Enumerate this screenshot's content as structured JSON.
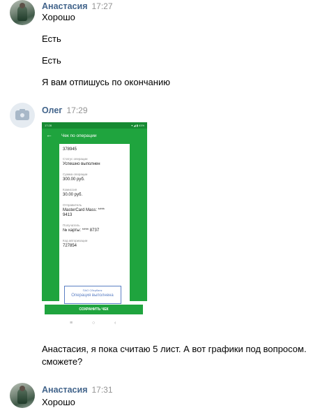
{
  "messages": [
    {
      "author": "Анастасия",
      "time": "17:27",
      "avatar": "user-photo",
      "lines": [
        "Хорошо",
        "Есть",
        "Есть",
        "Я вам отпишусь по окончанию"
      ]
    },
    {
      "author": "Олег",
      "time": "17:29",
      "avatar": "camera-placeholder-icon",
      "attachment": {
        "screen_title": "Чек по операции",
        "receipt_number": "378945",
        "fields": [
          {
            "label": "Статус операции",
            "value": "Успешно выполнен"
          },
          {
            "label": "Сумма операции",
            "value": "300.00 руб."
          },
          {
            "label": "Комиссия",
            "value": "30.00 руб."
          },
          {
            "label": "Отправитель",
            "value": "MasterCard Mass: **** 9413"
          },
          {
            "label": "Получатель",
            "value": "№ карты: **** 8737"
          },
          {
            "label": "Код авторизации",
            "value": "727854"
          }
        ],
        "stamp_bank": "ПАО Сбербанк",
        "stamp_text": "Операция выполнена",
        "save_button": "СОХРАНИТЬ ЧЕК",
        "nav_icons": [
          "≡",
          "○",
          "‹"
        ]
      },
      "text": "Анастасия, я пока считаю 5 лист. А вот графики под вопросом. сможете?"
    },
    {
      "author": "Анастасия",
      "time": "17:31",
      "avatar": "user-photo",
      "lines": [
        "Хорошо"
      ]
    }
  ],
  "colors": {
    "author": "#42648b",
    "time": "#939393",
    "receipt_green": "#1fa43e"
  }
}
